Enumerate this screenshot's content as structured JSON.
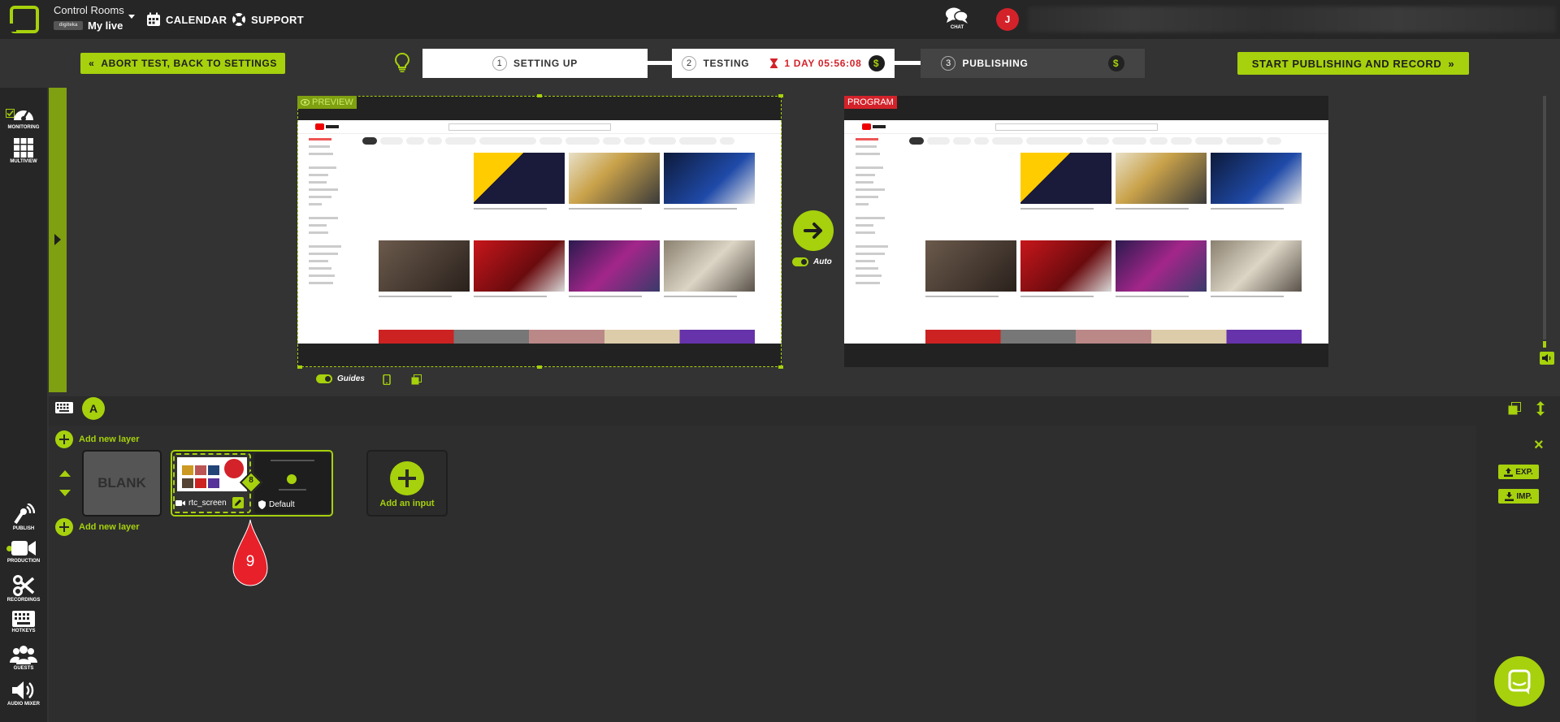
{
  "header": {
    "app_title": "Control Rooms",
    "live_name": "My live",
    "mini_logo_text": "digiteka",
    "nav": [
      {
        "label": "CALENDAR",
        "icon": "calendar-icon"
      },
      {
        "label": "SUPPORT",
        "icon": "lifebuoy-icon"
      }
    ],
    "chat_label": "CHAT",
    "avatar_initial": "J"
  },
  "actions": {
    "abort_label": "ABORT TEST, BACK TO SETTINGS",
    "start_label": "START PUBLISHING AND RECORD"
  },
  "steps": [
    {
      "num": "1",
      "label": "SETTING UP"
    },
    {
      "num": "2",
      "label": "TESTING",
      "timer": "1 DAY 05:56:08"
    },
    {
      "num": "3",
      "label": "PUBLISHING"
    }
  ],
  "dollar_symbol": "$",
  "screens": {
    "preview_label": "PREVIEW",
    "program_label": "PROGRAM",
    "auto_label": "Auto",
    "guides_label": "Guides"
  },
  "rail": [
    {
      "label": "MONITORING",
      "icon": "gauge-icon"
    },
    {
      "label": "MULTIVIEW",
      "icon": "grid-icon"
    },
    {
      "label": "PUBLISH",
      "icon": "broadcast-icon"
    },
    {
      "label": "PRODUCTION",
      "icon": "camera-icon"
    },
    {
      "label": "RECORDINGS",
      "icon": "scissors-icon"
    },
    {
      "label": "HOTKEYS",
      "icon": "keyboard-icon"
    },
    {
      "label": "GUESTS",
      "icon": "users-icon"
    },
    {
      "label": "AUDIO MIXER",
      "icon": "speaker-icon"
    }
  ],
  "production": {
    "scene_letter": "A",
    "add_layer_label": "Add new layer",
    "blank_label": "BLANK",
    "source_name": "rtc_screen",
    "layout_name": "Default",
    "layer_index": "8",
    "add_input_label": "Add an input",
    "export_label": "EXP.",
    "import_label": "IMP."
  },
  "marker": {
    "label": "9"
  },
  "colors": {
    "accent": "#a6d10c",
    "danger": "#d3222a",
    "background": "#333333"
  }
}
